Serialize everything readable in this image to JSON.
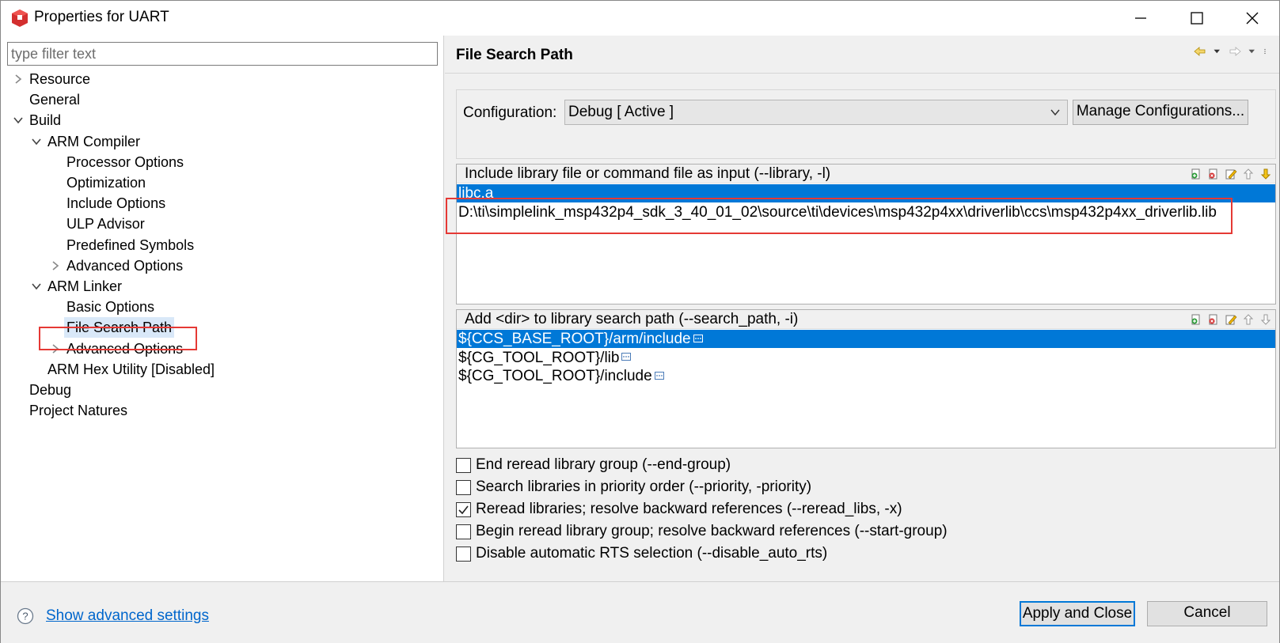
{
  "window": {
    "title": "Properties for UART"
  },
  "filter": {
    "placeholder": "type filter text",
    "value": ""
  },
  "tree": [
    {
      "label": "Resource",
      "level": 0,
      "twisty": "right"
    },
    {
      "label": "General",
      "level": 0,
      "twisty": ""
    },
    {
      "label": "Build",
      "level": 0,
      "twisty": "down"
    },
    {
      "label": "ARM Compiler",
      "level": 1,
      "twisty": "down"
    },
    {
      "label": "Processor Options",
      "level": 2,
      "twisty": ""
    },
    {
      "label": "Optimization",
      "level": 2,
      "twisty": ""
    },
    {
      "label": "Include Options",
      "level": 2,
      "twisty": ""
    },
    {
      "label": "ULP Advisor",
      "level": 2,
      "twisty": ""
    },
    {
      "label": "Predefined Symbols",
      "level": 2,
      "twisty": ""
    },
    {
      "label": "Advanced Options",
      "level": 2,
      "twisty": "right"
    },
    {
      "label": "ARM Linker",
      "level": 1,
      "twisty": "down"
    },
    {
      "label": "Basic Options",
      "level": 2,
      "twisty": ""
    },
    {
      "label": "File Search Path",
      "level": 2,
      "twisty": "",
      "selected": true
    },
    {
      "label": "Advanced Options",
      "level": 2,
      "twisty": "right"
    },
    {
      "label": "ARM Hex Utility  [Disabled]",
      "level": 1,
      "twisty": ""
    },
    {
      "label": "Debug",
      "level": 0,
      "twisty": ""
    },
    {
      "label": "Project Natures",
      "level": 0,
      "twisty": ""
    }
  ],
  "page": {
    "title": "File Search Path"
  },
  "configuration": {
    "label": "Configuration:",
    "selected": "Debug  [ Active ]",
    "manage_label": "Manage Configurations..."
  },
  "library_list": {
    "title": "Include library file or command file as input (--library, -l)",
    "items": [
      {
        "text": "libc.a",
        "selected": true
      },
      {
        "text": "D:\\ti\\simplelink_msp432p4_sdk_3_40_01_02\\source\\ti\\devices\\msp432p4xx\\driverlib\\ccs\\msp432p4xx_driverlib.lib",
        "selected": false
      }
    ]
  },
  "search_path_list": {
    "title": "Add <dir> to library search path (--search_path, -i)",
    "items": [
      {
        "text": "${CCS_BASE_ROOT}/arm/include",
        "selected": true
      },
      {
        "text": "${CG_TOOL_ROOT}/lib",
        "selected": false
      },
      {
        "text": "${CG_TOOL_ROOT}/include",
        "selected": false
      }
    ]
  },
  "options": [
    {
      "label": "End reread library group (--end-group)",
      "checked": false
    },
    {
      "label": "Search libraries in priority order (--priority, -priority)",
      "checked": false
    },
    {
      "label": "Reread libraries; resolve backward references (--reread_libs, -x)",
      "checked": true
    },
    {
      "label": "Begin reread library group; resolve backward references (--start-group)",
      "checked": false
    },
    {
      "label": "Disable automatic RTS selection (--disable_auto_rts)",
      "checked": false
    }
  ],
  "footer": {
    "advanced_link": "Show advanced settings",
    "apply_label": "Apply and Close",
    "cancel_label": "Cancel"
  },
  "colors": {
    "selection": "#0078d7",
    "highlight_box": "#e53935",
    "tree_selection": "#d9e8f8",
    "link": "#0066cc"
  }
}
